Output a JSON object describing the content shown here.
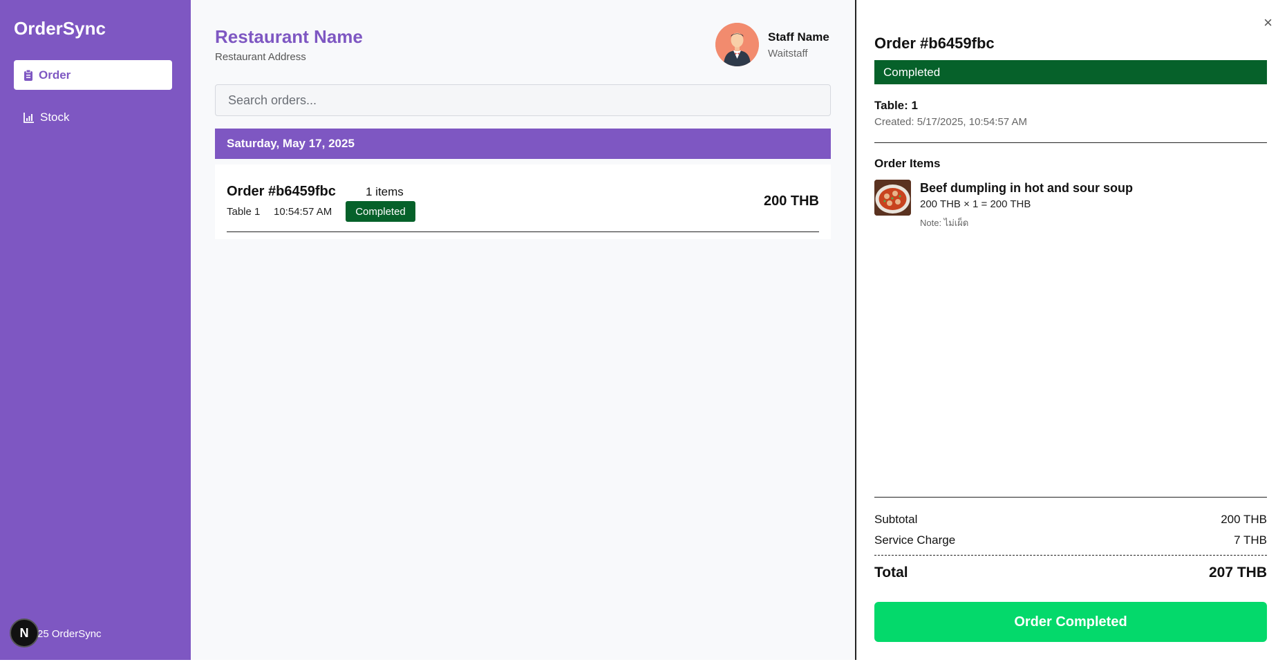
{
  "sidebar": {
    "brand": "OrderSync",
    "items": [
      {
        "label": "Order",
        "icon": "clipboard-icon",
        "active": true
      },
      {
        "label": "Stock",
        "icon": "bar-chart-icon",
        "active": false
      }
    ],
    "footer": "25 OrderSync",
    "next_badge": "N"
  },
  "header": {
    "restaurant_name": "Restaurant Name",
    "restaurant_address": "Restaurant Address",
    "staff_name": "Staff Name",
    "staff_role": "Waitstaff"
  },
  "search": {
    "placeholder": "Search orders..."
  },
  "orders": {
    "date": "Saturday, May 17, 2025",
    "list": [
      {
        "id": "Order #b6459fbc",
        "items": "1 items",
        "table": "Table 1",
        "time": "10:54:57 AM",
        "status": "Completed",
        "total": "200 THB"
      }
    ]
  },
  "detail": {
    "close": "×",
    "title": "Order #b6459fbc",
    "status": "Completed",
    "table": "Table: 1",
    "created": "Created: 5/17/2025, 10:54:57 AM",
    "items_title": "Order Items",
    "items": [
      {
        "name": "Beef dumpling in hot and sour soup",
        "price_line": "200 THB × 1 = 200 THB",
        "note": "Note: ไม่เผ็ด"
      }
    ],
    "subtotal_label": "Subtotal",
    "subtotal_value": "200 THB",
    "service_label": "Service Charge",
    "service_value": "7 THB",
    "total_label": "Total",
    "total_value": "207 THB",
    "complete_button": "Order Completed"
  },
  "colors": {
    "brand_purple": "#7e57c2",
    "status_green": "#06612a",
    "action_green": "#04d96b"
  }
}
